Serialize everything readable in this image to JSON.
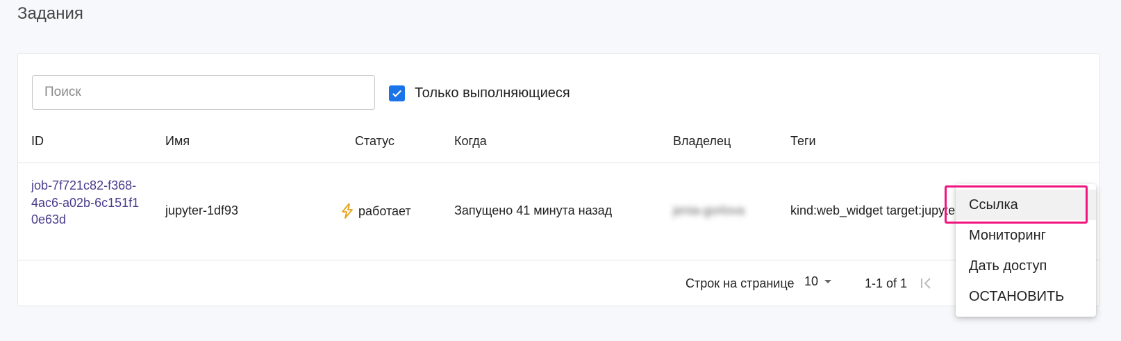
{
  "page": {
    "title": "Задания"
  },
  "filters": {
    "search_placeholder": "Поиск",
    "search_value": "",
    "only_running_label": "Только выполняющиеся",
    "only_running_checked": true
  },
  "table": {
    "headers": {
      "id": "ID",
      "name": "Имя",
      "status": "Статус",
      "when": "Когда",
      "owner": "Владелец",
      "tags": "Теги"
    },
    "rows": [
      {
        "id": "job-7f721c82-f368-4ac6-a02b-6c151f10e63d",
        "name": "jupyter-1df93",
        "status": "работает",
        "status_icon": "lightning-icon",
        "when": "Запущено 41 минута назад",
        "owner": "jenia-gorlova",
        "tags": "kind:web_widget target:jupyter"
      }
    ]
  },
  "pagination": {
    "rows_per_page_label": "Строк на странице",
    "rows_per_page_value": "10",
    "range_label": "1-1 of 1"
  },
  "context_menu": {
    "items": [
      "Ссылка",
      "Мониторинг",
      "Дать доступ",
      "ОСТАНОВИТЬ"
    ],
    "highlighted_index": 0
  },
  "colors": {
    "accent": "#1a73e8",
    "link": "#4a3b8c",
    "highlight": "#f0157e",
    "status_icon": "#e8a317"
  }
}
